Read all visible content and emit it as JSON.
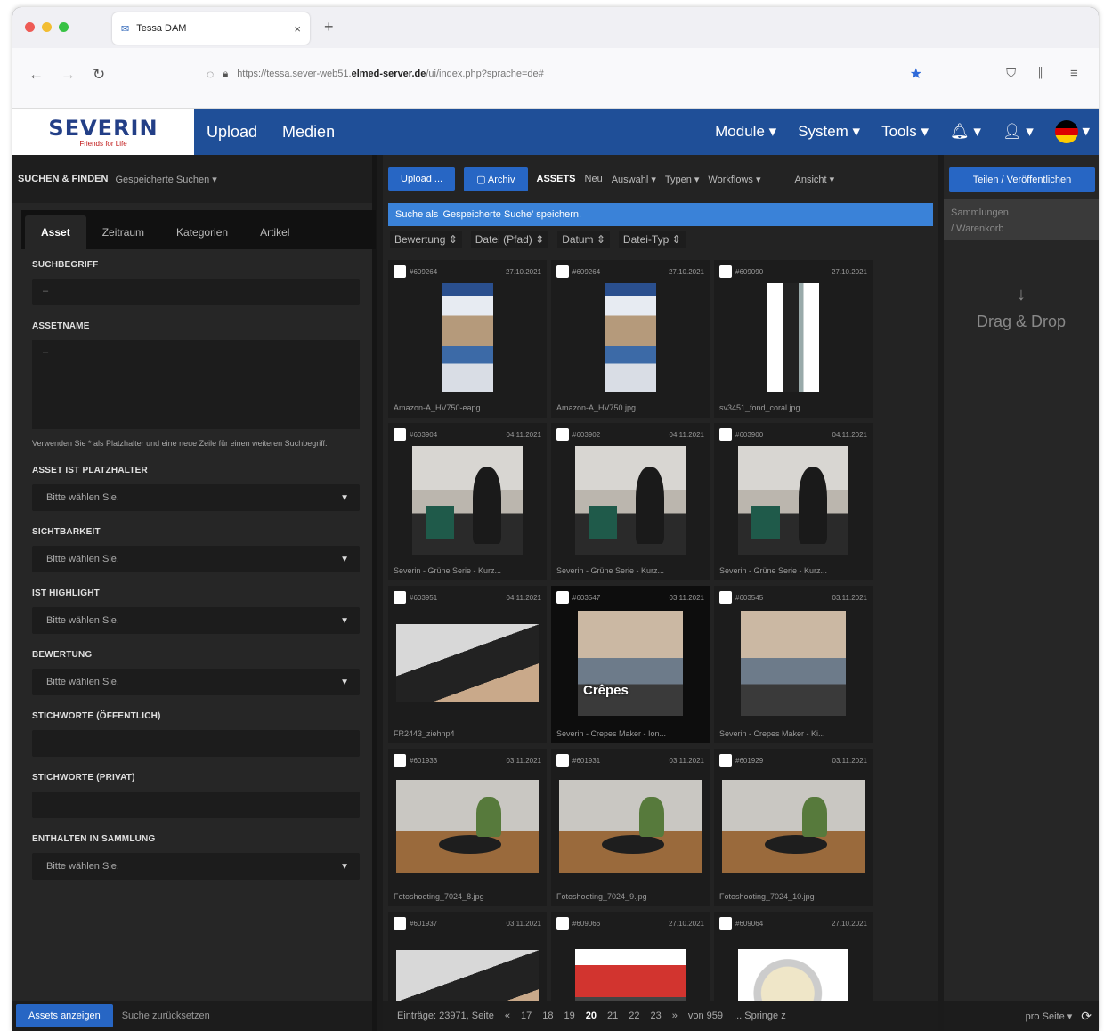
{
  "browser": {
    "tab_title": "Tessa DAM",
    "tab_close": "×",
    "new_tab": "+",
    "url_prefix": "https://tessa.sever-web51.",
    "url_domain": "elmed-server.de",
    "url_path": "/ui/index.php?sprache=de#"
  },
  "header": {
    "brand": "SEVERIN",
    "brand_tagline": "Friends for Life",
    "nav": [
      "Upload",
      "Medien"
    ],
    "right_nav": [
      "Module ▾",
      "System ▾",
      "Tools ▾"
    ]
  },
  "left": {
    "title": "SUCHEN & FINDEN",
    "saved_searches": "Gespeicherte Suchen ▾",
    "tabs": [
      "Asset",
      "Zeitraum",
      "Kategorien",
      "Artikel"
    ],
    "fields": {
      "suchbegriff_label": "SUCHBEGRIFF",
      "suchbegriff_value": "–",
      "assetname_label": "ASSETNAME",
      "assetname_value": "–",
      "hint": "Verwenden Sie * als Platzhalter und eine neue Zeile für einen weiteren Suchbegriff.",
      "platzhalter_label": "ASSET IST PLATZHALTER",
      "sichtbarkeit_label": "SICHTBARKEIT",
      "highlight_label": "IST HIGHLIGHT",
      "bewertung_label": "BEWERTUNG",
      "stich_oeff_label": "STICHWORTE (ÖFFENTLICH)",
      "stich_priv_label": "STICHWORTE (PRIVAT)",
      "sammlung_label": "ENTHALTEN IN SAMMLUNG",
      "select_placeholder": "Bitte wählen Sie."
    },
    "footer": {
      "show_button": "Assets anzeigen",
      "reset": "Suche zurücksetzen"
    }
  },
  "center": {
    "toolbar": {
      "upload": "Upload ...",
      "archive": "▢ Archiv",
      "assets": "ASSETS",
      "neu": "Neu",
      "auswahl": "Auswahl ▾",
      "typen": "Typen ▾",
      "workflows": "Workflows ▾",
      "ansicht": "Ansicht ▾"
    },
    "save_search": "Suche als 'Gespeicherte Suche' speichern.",
    "sort": [
      "Bewertung ⇕",
      "Datei (Pfad) ⇕",
      "Datum ⇕",
      "Datei-Typ ⇕"
    ],
    "cards": [
      {
        "id": "#609264",
        "date": "27.10.2021",
        "name": "Amazon-A_HV750-eapg",
        "art": "flyer"
      },
      {
        "id": "#609264",
        "date": "27.10.2021",
        "name": "Amazon-A_HV750.jpg",
        "art": "flyer"
      },
      {
        "id": "#609090",
        "date": "27.10.2021",
        "name": "sv3451_fond_coral.jpg",
        "art": "device"
      },
      {
        "id": "#603904",
        "date": "04.11.2021",
        "name": "Severin - Grüne Serie - Kurz...",
        "art": "kitchen"
      },
      {
        "id": "#603902",
        "date": "04.11.2021",
        "name": "Severin - Grüne Serie - Kurz...",
        "art": "kitchen"
      },
      {
        "id": "#603900",
        "date": "04.11.2021",
        "name": "Severin - Grüne Serie - Kurz...",
        "art": "kitchen"
      },
      {
        "id": "#603951",
        "date": "04.11.2021",
        "name": "FR2443_ziehnp4",
        "art": "pan"
      },
      {
        "id": "#603547",
        "date": "03.11.2021",
        "name": "Severin - Crepes Maker - Ion...",
        "art": "crepes",
        "label": "Crêpes"
      },
      {
        "id": "#603545",
        "date": "03.11.2021",
        "name": "Severin - Crepes Maker - Ki...",
        "art": "crepes"
      },
      {
        "id": "#601933",
        "date": "03.11.2021",
        "name": "Fotoshooting_7024_8.jpg",
        "art": "robot"
      },
      {
        "id": "#601931",
        "date": "03.11.2021",
        "name": "Fotoshooting_7024_9.jpg",
        "art": "robot"
      },
      {
        "id": "#601929",
        "date": "03.11.2021",
        "name": "Fotoshooting_7024_10.jpg",
        "art": "robot"
      },
      {
        "id": "#601937",
        "date": "03.11.2021",
        "name": "",
        "art": "pan"
      },
      {
        "id": "#609066",
        "date": "27.10.2021",
        "name": "",
        "art": "mixer"
      },
      {
        "id": "#609064",
        "date": "27.10.2021",
        "name": "",
        "art": "bowl"
      }
    ],
    "pager": {
      "entries": "Einträge: 23971, Seite",
      "prev": "«",
      "pages": [
        "17",
        "18",
        "19",
        "20",
        "21",
        "22",
        "23"
      ],
      "current": "20",
      "next": "»",
      "of": "von 959",
      "jump": "... Springe z"
    }
  },
  "right": {
    "share": "Teilen / Veröffentlichen",
    "collections": "Sammlungen",
    "basket": "/ Warenkorb",
    "dnd_arrow": "↓",
    "dnd": "Drag & Drop",
    "per_page": "pro Seite ▾",
    "refresh": "⟳"
  },
  "colors": {
    "header_blue": "#1f4f98",
    "button_blue": "#2766c4",
    "brand_blue": "#233f87",
    "brand_red": "#c01818"
  }
}
